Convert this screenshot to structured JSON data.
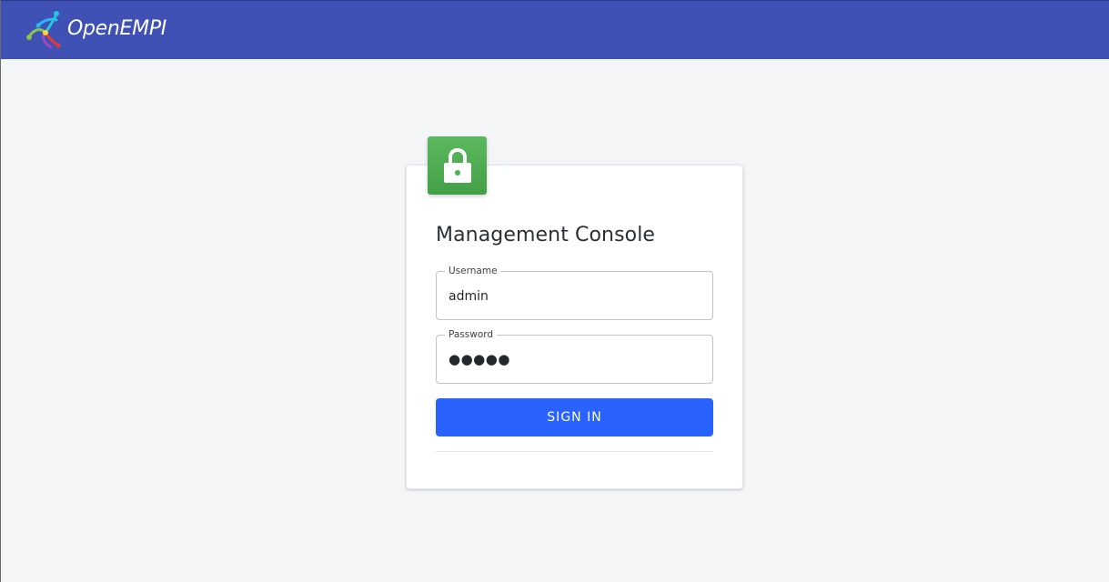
{
  "header": {
    "brand": "OpenEMPI",
    "background_color": "#3f51b5"
  },
  "login": {
    "icon": "lock-icon",
    "icon_color": "#4caf50",
    "title": "Management Console",
    "username": {
      "label": "Username",
      "value": "admin"
    },
    "password": {
      "label": "Password",
      "value": "●●●●●"
    },
    "sign_in_label": "SIGN IN",
    "button_color": "#2962ff"
  }
}
